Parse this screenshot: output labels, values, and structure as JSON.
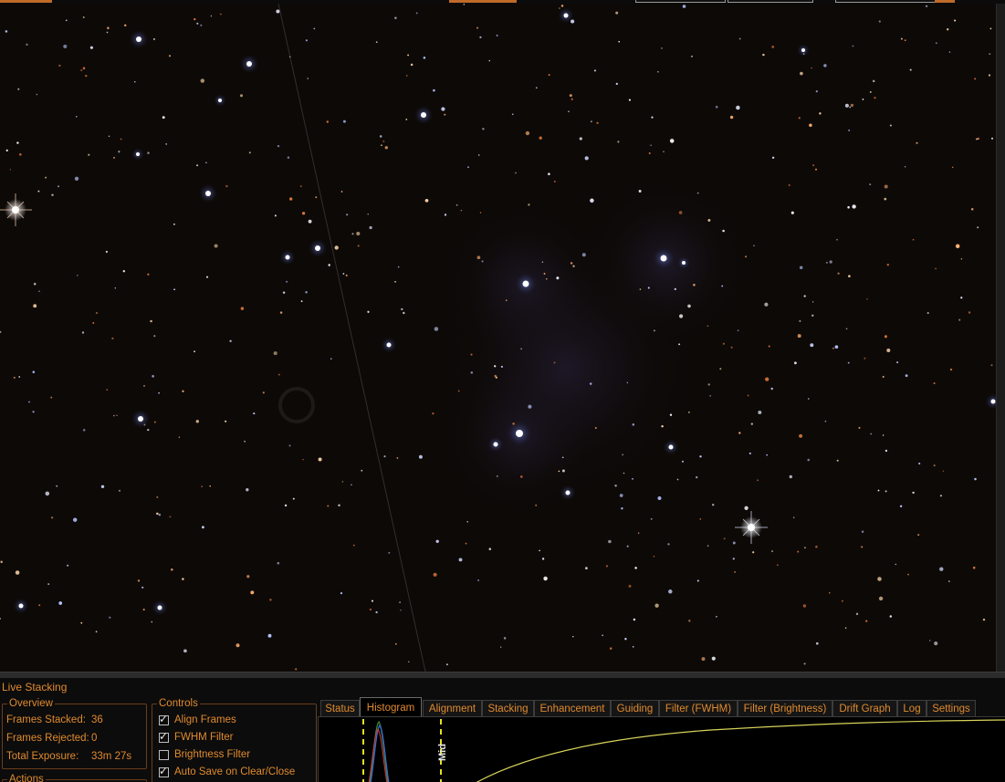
{
  "colors": {
    "panel_bg": "#0c0c0c",
    "label_orange": "#e08a2e",
    "group_border": "#6a3d1a",
    "sky_bg": "#0d0907",
    "marker_yellow": "#e8e020",
    "curve_yellow": "#d8d35a"
  },
  "panel": {
    "title": "Live Stacking"
  },
  "overview": {
    "label": "Overview",
    "frames_stacked_label": "Frames Stacked:",
    "frames_stacked_value": "36",
    "frames_rejected_label": "Frames Rejected:",
    "frames_rejected_value": "0",
    "total_exposure_label": "Total Exposure:",
    "total_exposure_value": "33m 27s"
  },
  "actions": {
    "label": "Actions"
  },
  "controls": {
    "label": "Controls",
    "items": [
      {
        "label": "Align Frames",
        "checked": true
      },
      {
        "label": "FWHM Filter",
        "checked": true
      },
      {
        "label": "Brightness Filter",
        "checked": false
      },
      {
        "label": "Auto Save on Clear/Close",
        "checked": true
      }
    ]
  },
  "tabs": [
    {
      "label": "Status",
      "active": false
    },
    {
      "label": "Histogram",
      "active": true
    },
    {
      "label": "Alignment",
      "active": false
    },
    {
      "label": "Stacking",
      "active": false
    },
    {
      "label": "Enhancement",
      "active": false
    },
    {
      "label": "Guiding",
      "active": false
    },
    {
      "label": "Filter (FWHM)",
      "active": false
    },
    {
      "label": "Filter (Brightness)",
      "active": false
    },
    {
      "label": "Drift Graph",
      "active": false
    },
    {
      "label": "Log",
      "active": false
    },
    {
      "label": "Settings",
      "active": false
    }
  ],
  "histogram": {
    "mid_label": "Mid"
  },
  "icons": {
    "checkbox_tick": "✓"
  }
}
